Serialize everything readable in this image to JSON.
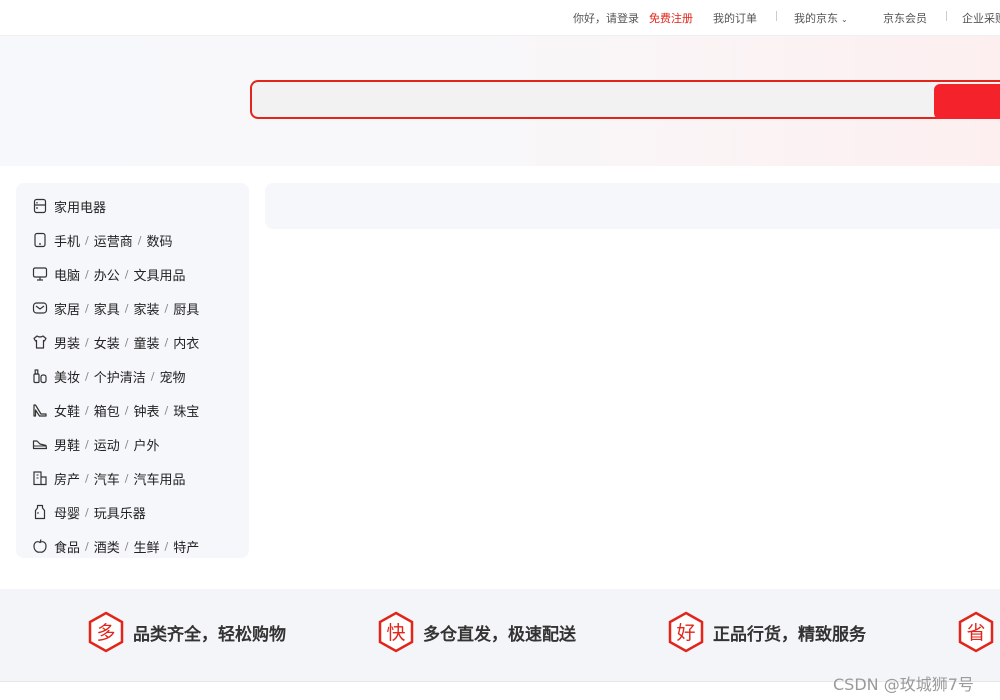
{
  "topbar": {
    "greeting": "你好，请登录",
    "register": "免费注册",
    "orders": "我的订单",
    "my_jd": "我的京东",
    "member": "京东会员",
    "enterprise": "企业采购"
  },
  "search": {
    "value": "",
    "placeholder": ""
  },
  "categories": [
    {
      "icon": "appliance-icon",
      "parts": [
        "家用电器"
      ]
    },
    {
      "icon": "phone-icon",
      "parts": [
        "手机",
        "运营商",
        "数码"
      ]
    },
    {
      "icon": "computer-icon",
      "parts": [
        "电脑",
        "办公",
        "文具用品"
      ]
    },
    {
      "icon": "sofa-icon",
      "parts": [
        "家居",
        "家具",
        "家装",
        "厨具"
      ]
    },
    {
      "icon": "shirt-icon",
      "parts": [
        "男装",
        "女装",
        "童装",
        "内衣"
      ]
    },
    {
      "icon": "cosmetics-icon",
      "parts": [
        "美妆",
        "个护清洁",
        "宠物"
      ]
    },
    {
      "icon": "high-heel-icon",
      "parts": [
        "女鞋",
        "箱包",
        "钟表",
        "珠宝"
      ]
    },
    {
      "icon": "sneaker-icon",
      "parts": [
        "男鞋",
        "运动",
        "户外"
      ]
    },
    {
      "icon": "building-icon",
      "parts": [
        "房产",
        "汽车",
        "汽车用品"
      ]
    },
    {
      "icon": "baby-bottle-icon",
      "parts": [
        "母婴",
        "玩具乐器"
      ]
    },
    {
      "icon": "apple-icon",
      "parts": [
        "食品",
        "酒类",
        "生鲜",
        "特产"
      ]
    }
  ],
  "features": [
    {
      "badge": "多",
      "text": "品类齐全，轻松购物"
    },
    {
      "badge": "快",
      "text": "多仓直发，极速配送"
    },
    {
      "badge": "好",
      "text": "正品行货，精致服务"
    },
    {
      "badge": "省",
      "text": ""
    }
  ],
  "watermark": "CSDN @玫城狮7号",
  "colors": {
    "brand_red": "#e1251b",
    "button_red": "#f3222b"
  }
}
